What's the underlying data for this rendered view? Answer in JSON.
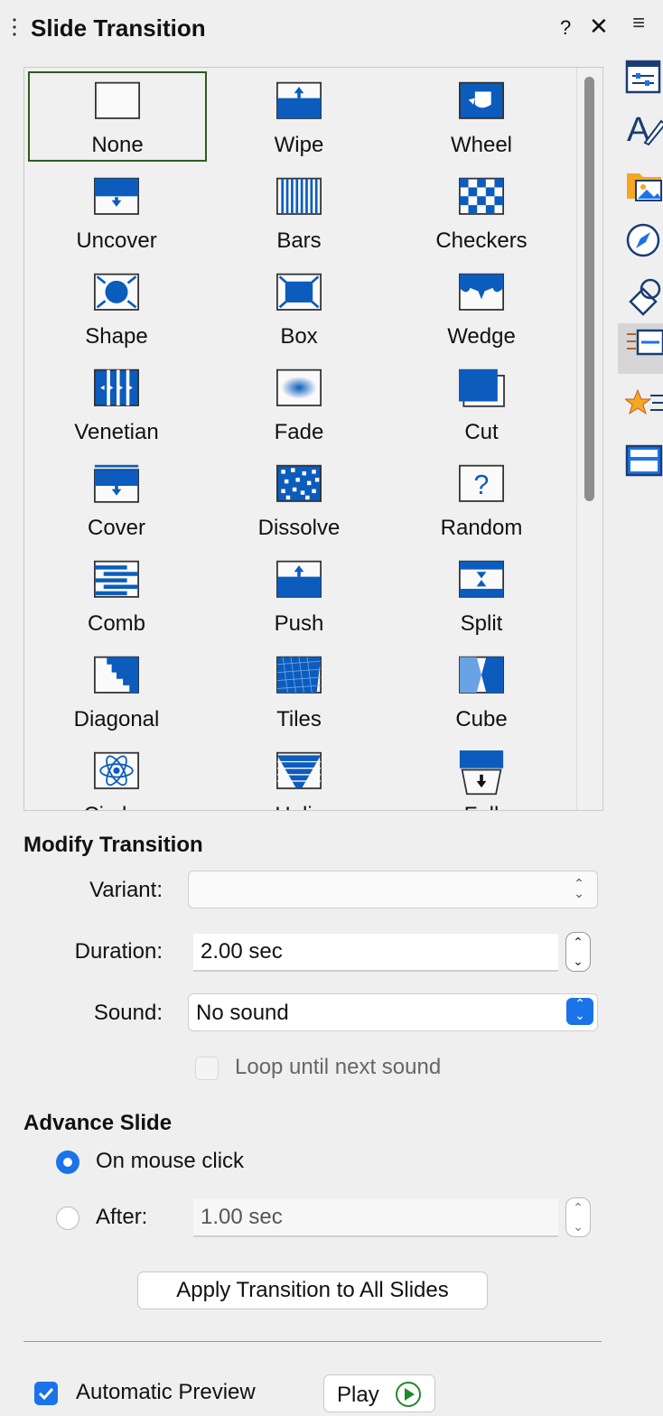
{
  "panel": {
    "title": "Slide Transition",
    "help": "?",
    "close": "✕",
    "menu": "≡"
  },
  "transitions": [
    {
      "label": "None",
      "icon": "none-icon"
    },
    {
      "label": "Wipe",
      "icon": "wipe-icon"
    },
    {
      "label": "Wheel",
      "icon": "wheel-icon"
    },
    {
      "label": "Uncover",
      "icon": "uncover-icon"
    },
    {
      "label": "Bars",
      "icon": "bars-icon"
    },
    {
      "label": "Checkers",
      "icon": "checkers-icon"
    },
    {
      "label": "Shape",
      "icon": "shape-icon"
    },
    {
      "label": "Box",
      "icon": "box-icon"
    },
    {
      "label": "Wedge",
      "icon": "wedge-icon"
    },
    {
      "label": "Venetian",
      "icon": "venetian-icon"
    },
    {
      "label": "Fade",
      "icon": "fade-icon"
    },
    {
      "label": "Cut",
      "icon": "cut-icon"
    },
    {
      "label": "Cover",
      "icon": "cover-icon"
    },
    {
      "label": "Dissolve",
      "icon": "dissolve-icon"
    },
    {
      "label": "Random",
      "icon": "random-icon"
    },
    {
      "label": "Comb",
      "icon": "comb-icon"
    },
    {
      "label": "Push",
      "icon": "push-icon"
    },
    {
      "label": "Split",
      "icon": "split-icon"
    },
    {
      "label": "Diagonal",
      "icon": "diagonal-icon"
    },
    {
      "label": "Tiles",
      "icon": "tiles-icon"
    },
    {
      "label": "Cube",
      "icon": "cube-icon"
    },
    {
      "label": "Circles",
      "icon": "circles-icon"
    },
    {
      "label": "Helix",
      "icon": "helix-icon"
    },
    {
      "label": "Fall",
      "icon": "fall-icon"
    }
  ],
  "selected_transition": "None",
  "modify": {
    "heading": "Modify Transition",
    "variant_label": "Variant:",
    "variant_value": "",
    "duration_label": "Duration:",
    "duration_value": "2.00 sec",
    "sound_label": "Sound:",
    "sound_value": "No sound",
    "loop_label": "Loop until next sound",
    "loop_checked": false
  },
  "advance": {
    "heading": "Advance Slide",
    "on_click_label": "On mouse click",
    "on_click_selected": true,
    "after_label": "After:",
    "after_value": "1.00 sec"
  },
  "apply_all_label": "Apply Transition to All Slides",
  "preview": {
    "auto_label": "Automatic Preview",
    "auto_checked": true,
    "play_label": "Play"
  },
  "sidebar_tabs": [
    "properties-icon",
    "styles-icon",
    "gallery-icon",
    "navigator-icon",
    "shapes-icon",
    "slide-transition-icon",
    "animation-icon",
    "master-slides-icon"
  ],
  "colors": {
    "accent": "#1a73e8",
    "icon_blue": "#0b5cbd",
    "selection": "#2d5d1f"
  }
}
